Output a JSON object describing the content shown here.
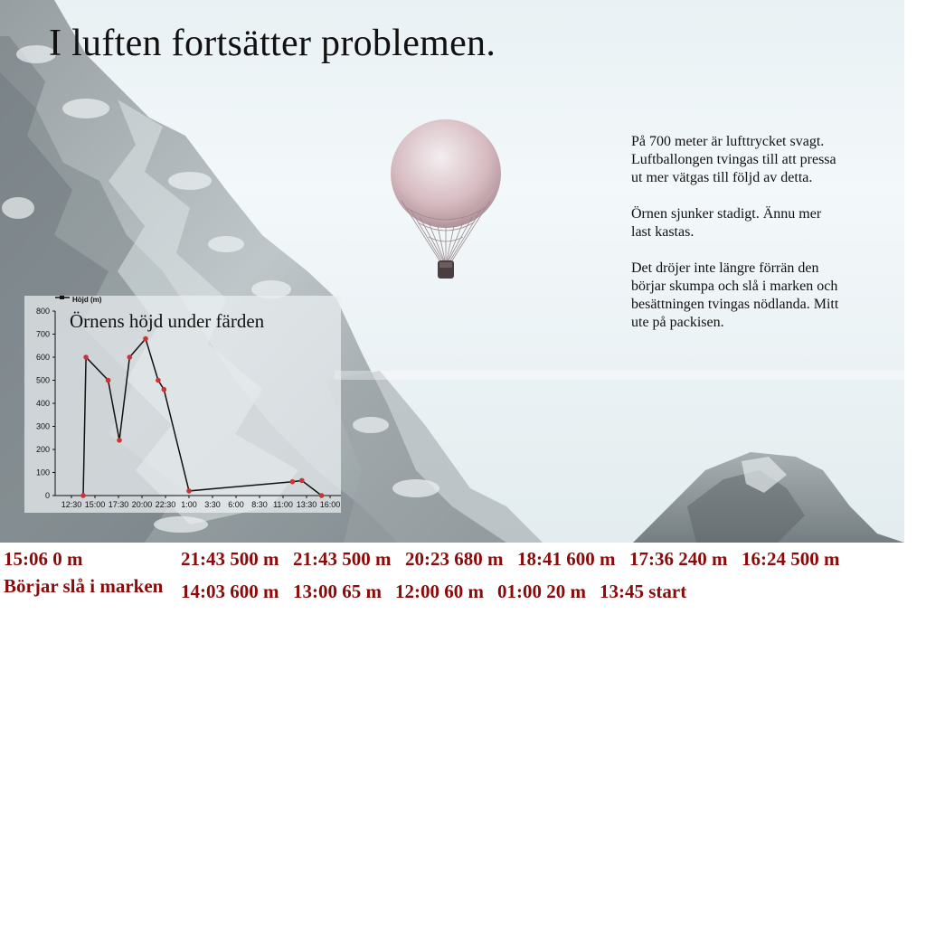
{
  "page": {
    "title": "I luften fortsätter problemen.",
    "paragraphs": [
      "På 700 meter är lufttrycket svagt. Luftballongen tvingas till att pressa ut mer vätgas till följd av detta.",
      "Örnen sjunker stadigt. Ännu mer last kastas.",
      "Det dröjer inte längre förrän den börjar skumpa och slå i marken och besättningen tvingas nödlanda. Mitt ute på packisen."
    ]
  },
  "icons": {
    "balloon": "hot-air-balloon-icon"
  },
  "colors": {
    "marker": "#cc3333",
    "line": "#111111",
    "label": "#8b0a0a"
  },
  "chart_data": {
    "type": "line",
    "title": "Örnens höjd under färden",
    "legend": "Höjd (m)",
    "legend_position": "top-left",
    "ylim": [
      0,
      800
    ],
    "yticks": [
      0,
      100,
      200,
      300,
      400,
      500,
      600,
      700,
      800
    ],
    "xticks": [
      "12:30",
      "15:00",
      "17:30",
      "20:00",
      "22:30",
      "1:00",
      "3:30",
      "6:00",
      "8:30",
      "11:00",
      "13:30",
      "16:00"
    ],
    "points": [
      {
        "t": "13:45",
        "y": 0
      },
      {
        "t": "14:03",
        "y": 600
      },
      {
        "t": "16:24",
        "y": 500
      },
      {
        "t": "17:36",
        "y": 240
      },
      {
        "t": "18:41",
        "y": 600
      },
      {
        "t": "20:23",
        "y": 680
      },
      {
        "t": "21:43",
        "y": 500
      },
      {
        "t": "22:20",
        "y": 460
      },
      {
        "t": "01:00",
        "y": 20
      },
      {
        "t": "12:00",
        "y": 60
      },
      {
        "t": "13:00",
        "y": 65
      },
      {
        "t": "15:06",
        "y": 0
      }
    ]
  },
  "labels": {
    "row1": [
      {
        "text": "15:06 0 m"
      },
      {
        "text": "21:43 500 m"
      },
      {
        "text": "21:43 500 m"
      },
      {
        "text": "20:23 680 m"
      },
      {
        "text": "18:41 600 m"
      },
      {
        "text": "17:36 240 m"
      },
      {
        "text": "16:24 500 m"
      }
    ],
    "row2": [
      {
        "text": "Börjar slå i marken"
      },
      {
        "text": "14:03 600 m"
      },
      {
        "text": "13:00 65 m"
      },
      {
        "text": "12:00 60 m"
      },
      {
        "text": "01:00 20 m"
      },
      {
        "text": "13:45 start"
      }
    ]
  }
}
